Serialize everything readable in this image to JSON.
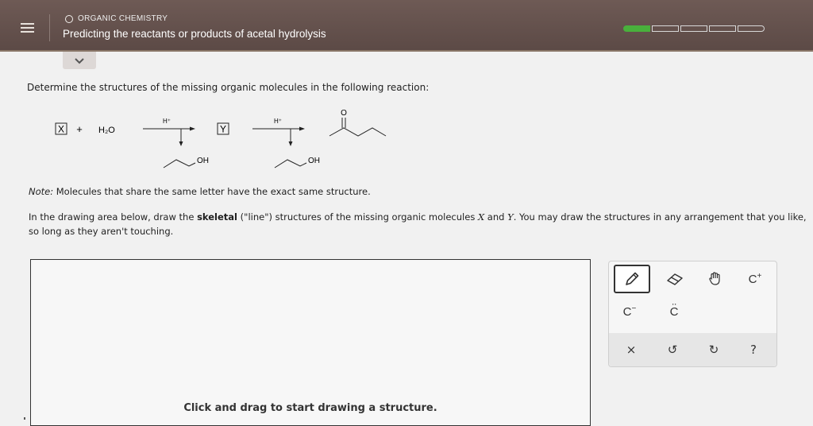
{
  "header": {
    "topic": "ORGANIC CHEMISTRY",
    "title": "Predicting the reactants or products of acetal hydrolysis",
    "progress": {
      "filled": 1,
      "total": 5,
      "color": "#49b03c"
    },
    "background": "#5f4d49"
  },
  "question": {
    "prompt": "Determine the structures of the missing organic molecules in the following reaction:",
    "reaction": {
      "reactant_box": "X",
      "plus": "+",
      "water": "H₂O",
      "catalyst_1": "H⁺",
      "reagent_1": "OH",
      "intermediate_box": "Y",
      "catalyst_2": "H⁺",
      "reagent_2": "OH",
      "carbonyl_label": "O"
    },
    "note_label": "Note:",
    "note_text": " Molecules that share the same letter have the exact same structure.",
    "instructions": {
      "part1": "In the drawing area below, draw the ",
      "bold": "skeletal",
      "part2": " (\"line\") structures of the missing organic molecules ",
      "var_x": "X",
      "and": " and ",
      "var_y": "Y",
      "part3": ". You may draw the structures in any arrangement that you like, so long as they aren't touching."
    }
  },
  "canvas": {
    "hint": "Click and drag to start drawing a structure."
  },
  "toolbox": {
    "tools": [
      {
        "icon": "pencil-icon",
        "selected": true
      },
      {
        "icon": "eraser-icon"
      },
      {
        "icon": "hand-icon"
      },
      {
        "icon": "carbocation-icon",
        "label": "C",
        "sup": "+"
      },
      {
        "icon": "carbanion-icon",
        "label": "C",
        "sup": "−"
      },
      {
        "icon": "carbene-icon",
        "label": "C",
        "dots": ":"
      }
    ],
    "footer": [
      {
        "icon": "close-icon",
        "label": "×"
      },
      {
        "icon": "undo-icon",
        "label": "↺"
      },
      {
        "icon": "redo-icon",
        "label": "↻"
      },
      {
        "icon": "help-icon",
        "label": "?"
      }
    ]
  }
}
